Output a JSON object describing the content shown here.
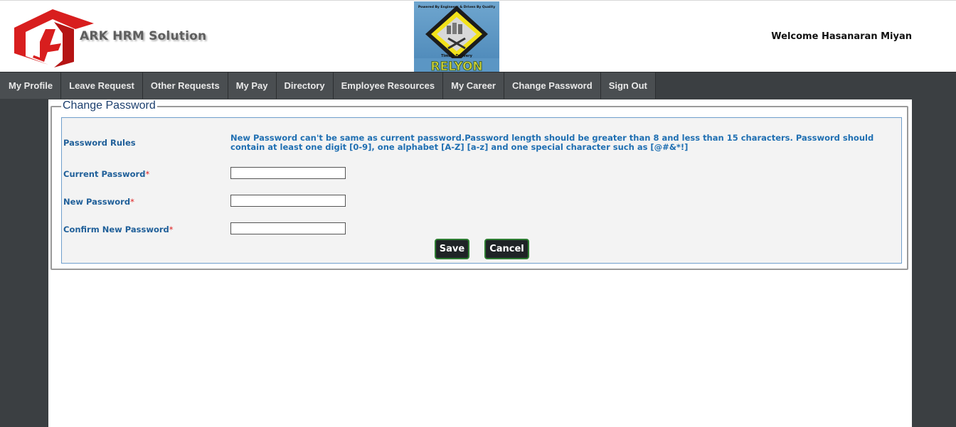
{
  "header": {
    "brand_name": "ARK HRM Solution",
    "welcome_text": "Welcome Hasanaran Miyan"
  },
  "client_logo": {
    "text": "RELYON",
    "tagline_top": "Powered By Engineers & Driven By Quality",
    "tagline_bottom": "Timely Delivery"
  },
  "nav": {
    "items": [
      {
        "label": "My Profile"
      },
      {
        "label": "Leave Request"
      },
      {
        "label": "Other Requests"
      },
      {
        "label": "My Pay"
      },
      {
        "label": "Directory"
      },
      {
        "label": "Employee Resources"
      },
      {
        "label": "My Career"
      },
      {
        "label": "Change Password"
      },
      {
        "label": "Sign Out"
      }
    ]
  },
  "form": {
    "legend": "Change Password",
    "rules_label": "Password Rules",
    "rules_text": "New Password can't be same as current password.Password length should be greater than 8 and less than 15 characters. Password should contain at least one digit [0-9], one alphabet [A-Z] [a-z] and one special character such as [@#&*!]",
    "current_label": "Current Password",
    "new_label": "New Password",
    "confirm_label": "Confirm New Password",
    "required_mark": "*",
    "current_value": "",
    "new_value": "",
    "confirm_value": "",
    "save_label": "Save",
    "cancel_label": "Cancel"
  },
  "colors": {
    "nav_bg": "#3b3f42",
    "label_blue": "#1f5f99",
    "brand_red": "#d81e1e",
    "button_border": "#2e7d32"
  }
}
